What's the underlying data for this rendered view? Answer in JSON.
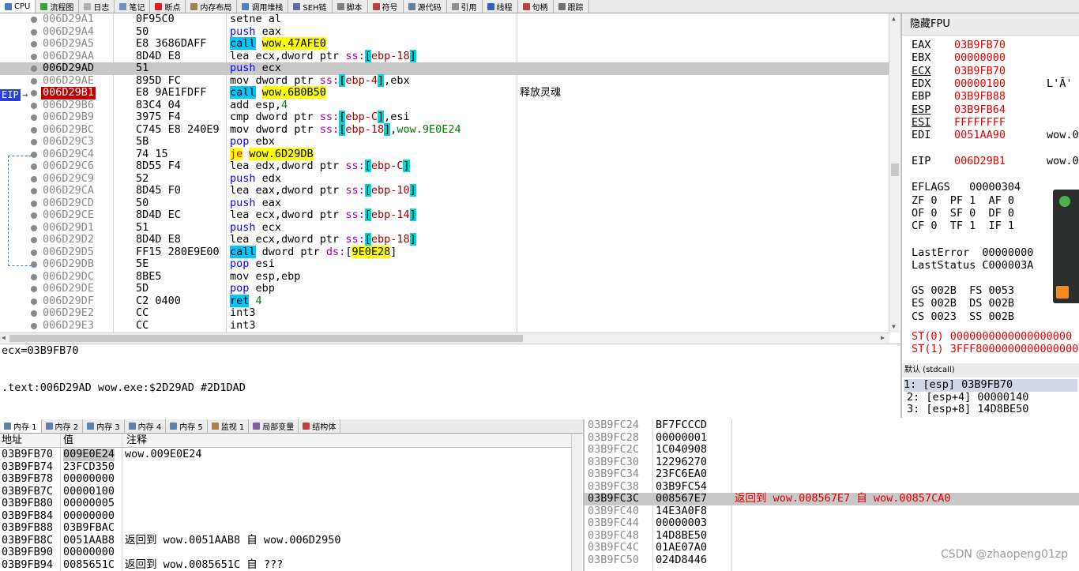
{
  "toolbar": {
    "tabs": [
      "CPU",
      "流程图",
      "日志",
      "笔记",
      "断点",
      "内存布局",
      "调用堆栈",
      "SEH链",
      "脚本",
      "符号",
      "源代码",
      "引用",
      "线程",
      "句柄",
      "跟踪"
    ],
    "icon_colors": [
      "#4a7ab8",
      "#3aa040",
      "#b0b0b0",
      "#7090c0",
      "#e02020",
      "#a08050",
      "#5080c0",
      "#6070a0",
      "#808080",
      "#c04040",
      "#6080a0",
      "#909090",
      "#3060c0",
      "#c04040",
      "#707070"
    ]
  },
  "disasm": {
    "eip_label": "EIP",
    "rows": [
      {
        "addr": "006D29A1",
        "bytes": "0F95C0",
        "instr": "setne al",
        "comment": ""
      },
      {
        "addr": "006D29A4",
        "bytes": "50",
        "instr": "push eax",
        "comment": ""
      },
      {
        "addr": "006D29A5",
        "bytes": "E8 3686DAFF",
        "instr": "call wow.47AFE0",
        "comment": ""
      },
      {
        "addr": "006D29AA",
        "bytes": "8D4D E8",
        "instr": "lea ecx,dword ptr ss:[ebp-18]",
        "comment": ""
      },
      {
        "addr": "006D29AD",
        "bytes": "51",
        "instr": "push ecx",
        "comment": ""
      },
      {
        "addr": "006D29AE",
        "bytes": "895D FC",
        "instr": "mov dword ptr ss:[ebp-4],ebx",
        "comment": ""
      },
      {
        "addr": "006D29B1",
        "bytes": "E8 9AE1FDFF",
        "instr": "call wow.6B0B50",
        "comment": "释放灵魂"
      },
      {
        "addr": "006D29B6",
        "bytes": "83C4 04",
        "instr": "add esp,4",
        "comment": ""
      },
      {
        "addr": "006D29B9",
        "bytes": "3975 F4",
        "instr": "cmp dword ptr ss:[ebp-C],esi",
        "comment": ""
      },
      {
        "addr": "006D29BC",
        "bytes": "C745 E8 240E9",
        "instr": "mov dword ptr ss:[ebp-18],wow.9E0E24",
        "comment": ""
      },
      {
        "addr": "006D29C3",
        "bytes": "5B",
        "instr": "pop ebx",
        "comment": ""
      },
      {
        "addr": "006D29C4",
        "bytes": "74 15",
        "instr": "je wow.6D29DB",
        "comment": ""
      },
      {
        "addr": "006D29C6",
        "bytes": "8D55 F4",
        "instr": "lea edx,dword ptr ss:[ebp-C]",
        "comment": ""
      },
      {
        "addr": "006D29C9",
        "bytes": "52",
        "instr": "push edx",
        "comment": ""
      },
      {
        "addr": "006D29CA",
        "bytes": "8D45 F0",
        "instr": "lea eax,dword ptr ss:[ebp-10]",
        "comment": ""
      },
      {
        "addr": "006D29CD",
        "bytes": "50",
        "instr": "push eax",
        "comment": ""
      },
      {
        "addr": "006D29CE",
        "bytes": "8D4D EC",
        "instr": "lea ecx,dword ptr ss:[ebp-14]",
        "comment": ""
      },
      {
        "addr": "006D29D1",
        "bytes": "51",
        "instr": "push ecx",
        "comment": ""
      },
      {
        "addr": "006D29D2",
        "bytes": "8D4D E8",
        "instr": "lea ecx,dword ptr ss:[ebp-18]",
        "comment": ""
      },
      {
        "addr": "006D29D5",
        "bytes": "FF15 280E9E00",
        "instr": "call dword ptr ds:[9E0E28]",
        "comment": ""
      },
      {
        "addr": "006D29DB",
        "bytes": "5E",
        "instr": "pop esi",
        "comment": ""
      },
      {
        "addr": "006D29DC",
        "bytes": "8BE5",
        "instr": "mov esp,ebp",
        "comment": ""
      },
      {
        "addr": "006D29DE",
        "bytes": "5D",
        "instr": "pop ebp",
        "comment": ""
      },
      {
        "addr": "006D29DF",
        "bytes": "C2 0400",
        "instr": "ret 4",
        "comment": ""
      },
      {
        "addr": "006D29E2",
        "bytes": "CC",
        "instr": "int3",
        "comment": ""
      },
      {
        "addr": "006D29E3",
        "bytes": "CC",
        "instr": "int3",
        "comment": ""
      }
    ]
  },
  "info": {
    "line1": "ecx=03B9FB70",
    "line2": ".text:006D29AD wow.exe:$2D29AD #2D1DAD"
  },
  "registers": {
    "header": "隐藏FPU",
    "lines": [
      {
        "name": "EAX",
        "value": "03B9FB70",
        "extra": "",
        "underline": false
      },
      {
        "name": "EBX",
        "value": "00000000",
        "extra": "",
        "underline": false
      },
      {
        "name": "ECX",
        "value": "03B9FB70",
        "extra": "",
        "underline": true
      },
      {
        "name": "EDX",
        "value": "00000100",
        "extra": "L'Ā'",
        "underline": false
      },
      {
        "name": "EBP",
        "value": "03B9FB88",
        "extra": "",
        "underline": false
      },
      {
        "name": "ESP",
        "value": "03B9FB64",
        "extra": "",
        "underline": true
      },
      {
        "name": "ESI",
        "value": "FFFFFFFF",
        "extra": "",
        "underline": true
      },
      {
        "name": "EDI",
        "value": "0051AA90",
        "extra": "wow.0",
        "underline": false
      }
    ],
    "eip": {
      "name": "EIP",
      "value": "006D29B1",
      "extra": "wow.0"
    },
    "eflags": "EFLAGS   00000304",
    "flags": [
      "ZF 0  PF 1  AF 0",
      "OF 0  SF 0  DF 0",
      "CF 0  TF 1  IF 1"
    ],
    "lasterror": "LastError  00000000",
    "laststatus": "LastStatus C000003A",
    "segs": [
      "GS 002B  FS 0053",
      "ES 002B  DS 002B",
      "CS 0023  SS 002B"
    ],
    "st0": "ST(0) 0000000000000000000",
    "st1": "ST(1) 3FFF8000000000000000"
  },
  "callconv": {
    "label": "默认 (stdcall)",
    "args": [
      "1: [esp] 03B9FB70",
      "2: [esp+4] 00000140",
      "3: [esp+8] 14D8BE50"
    ]
  },
  "dump": {
    "tabs": [
      "内存 1",
      "内存 2",
      "内存 3",
      "内存 4",
      "内存 5",
      "监视 1",
      "局部变量",
      "结构体"
    ],
    "col_addr": "地址",
    "col_val": "值",
    "col_cmt": "注释",
    "rows": [
      {
        "a": "03B9FB70",
        "v": "009E0E24",
        "c": "wow.009E0E24"
      },
      {
        "a": "03B9FB74",
        "v": "23FCD350",
        "c": ""
      },
      {
        "a": "03B9FB78",
        "v": "00000000",
        "c": ""
      },
      {
        "a": "03B9FB7C",
        "v": "00000100",
        "c": ""
      },
      {
        "a": "03B9FB80",
        "v": "00000005",
        "c": ""
      },
      {
        "a": "03B9FB84",
        "v": "00000000",
        "c": ""
      },
      {
        "a": "03B9FB88",
        "v": "03B9FBAC",
        "c": ""
      },
      {
        "a": "03B9FB8C",
        "v": "0051AAB8",
        "c": "返回到 wow.0051AAB8 自 wow.006D2950"
      },
      {
        "a": "03B9FB90",
        "v": "00000000",
        "c": ""
      },
      {
        "a": "03B9FB94",
        "v": "0085651C",
        "c": "返回到 wow.0085651C 自 ???"
      }
    ]
  },
  "stack": {
    "rows": [
      {
        "a": "03B9FC24",
        "v": "BF7FCCCD",
        "c": ""
      },
      {
        "a": "03B9FC28",
        "v": "00000001",
        "c": ""
      },
      {
        "a": "03B9FC2C",
        "v": "1C040908",
        "c": ""
      },
      {
        "a": "03B9FC30",
        "v": "12296270",
        "c": ""
      },
      {
        "a": "03B9FC34",
        "v": "23FC6EA0",
        "c": ""
      },
      {
        "a": "03B9FC38",
        "v": "03B9FC54",
        "c": ""
      },
      {
        "a": "03B9FC3C",
        "v": "008567E7",
        "c": "返回到 wow.008567E7 自 wow.00857CA0"
      },
      {
        "a": "03B9FC40",
        "v": "14E3A0F8",
        "c": ""
      },
      {
        "a": "03B9FC44",
        "v": "00000003",
        "c": ""
      },
      {
        "a": "03B9FC48",
        "v": "14D8BE50",
        "c": ""
      },
      {
        "a": "03B9FC4C",
        "v": "01AE07A0",
        "c": ""
      },
      {
        "a": "03B9FC50",
        "v": "024D8446",
        "c": ""
      }
    ]
  },
  "watermark": "CSDN @zhaopeng01zp"
}
